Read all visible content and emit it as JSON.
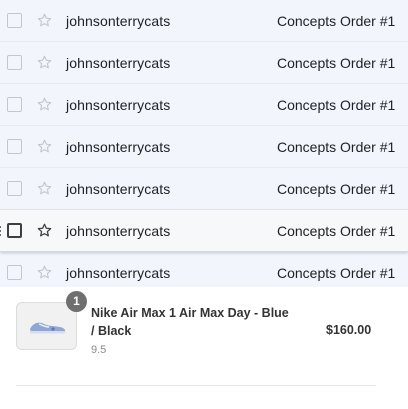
{
  "inbox": {
    "rows": [
      {
        "sender": "johnsonterrycats",
        "subject": "Concepts Order #1",
        "starred": false
      },
      {
        "sender": "johnsonterrycats",
        "subject": "Concepts Order #1",
        "starred": false
      },
      {
        "sender": "johnsonterrycats",
        "subject": "Concepts Order #1",
        "starred": false
      },
      {
        "sender": "johnsonterrycats",
        "subject": "Concepts Order #1",
        "starred": false
      },
      {
        "sender": "johnsonterrycats",
        "subject": "Concepts Order #1",
        "starred": false
      },
      {
        "sender": "johnsonterrycats",
        "subject": "Concepts Order #1",
        "starred": false,
        "hovered": true
      },
      {
        "sender": "johnsonterrycats",
        "subject": "Concepts Order #1",
        "starred": false
      }
    ]
  },
  "order_item": {
    "quantity": "1",
    "product_name_line1": "Nike Air Max 1 Air Max Day - Blue",
    "product_name_line2": "/ Black",
    "size": "9.5",
    "price": "$160.00"
  },
  "icons": {
    "star": "star-outline-icon",
    "checkbox": "checkbox-icon",
    "drag": "drag-handle-icon",
    "product": "sneaker-thumbnail"
  },
  "colors": {
    "row_bg": "#f2f6fc",
    "row_hover_bg": "#f7f8fa",
    "badge_bg": "#6f6f6f",
    "divider": "#e8eaed"
  }
}
